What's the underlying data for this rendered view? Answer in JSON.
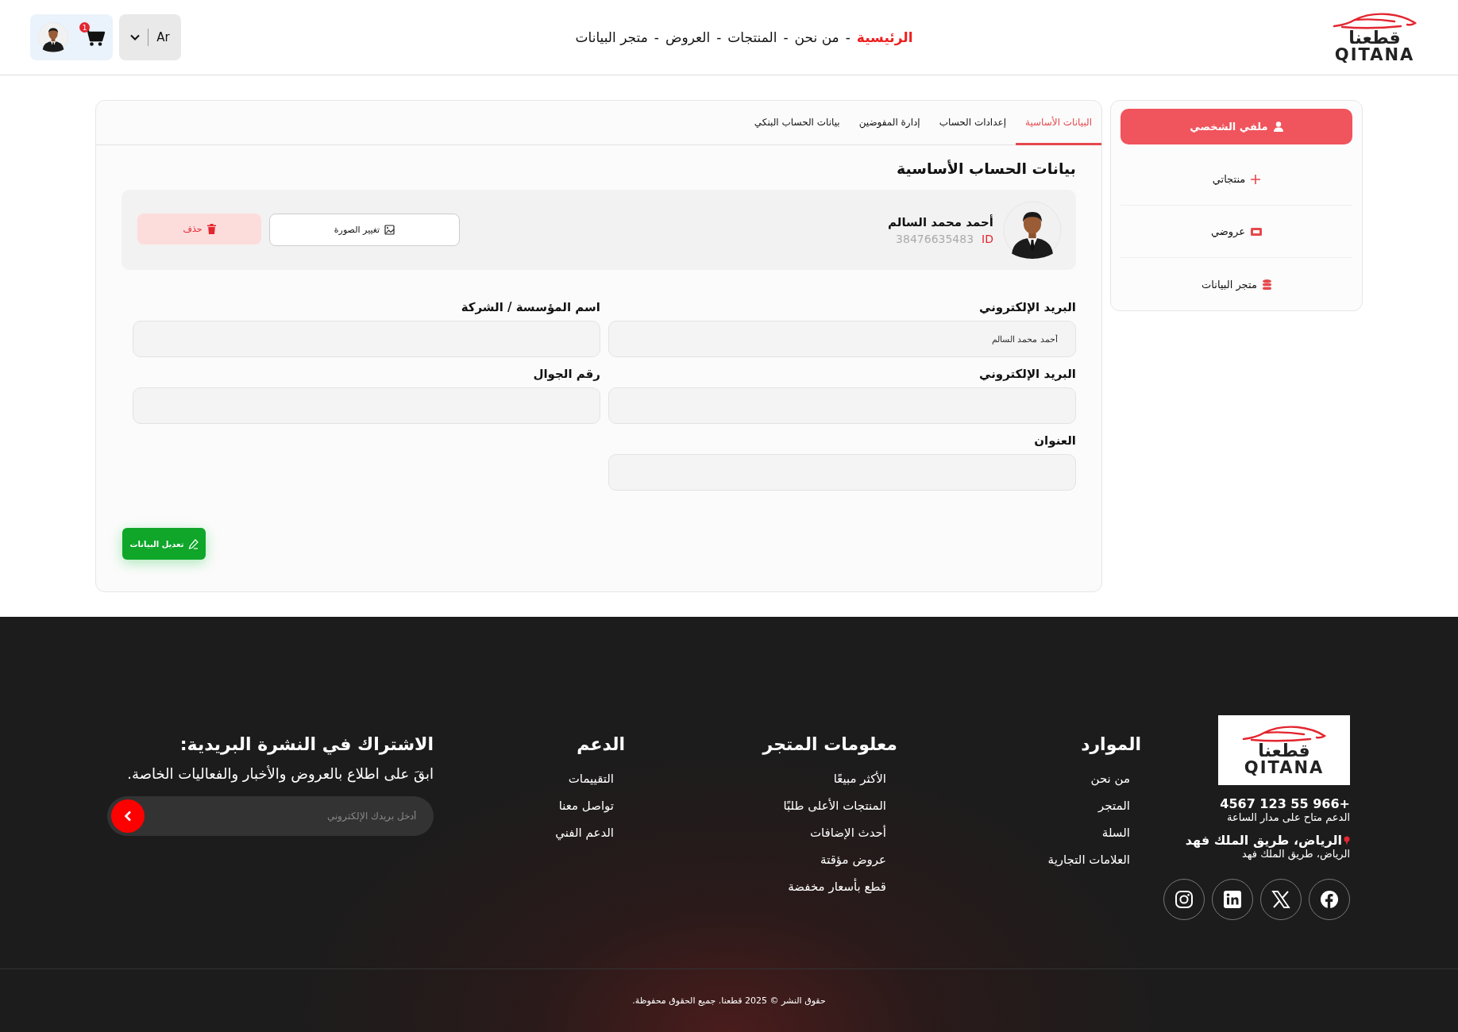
{
  "header": {
    "logo": {
      "arabic": "قطعنا",
      "latin": "QITANA"
    },
    "nav": [
      {
        "kind": "link",
        "label": "الرئيسية",
        "selected": true
      },
      {
        "kind": "separator",
        "label": "-"
      },
      {
        "kind": "link",
        "label": "من نحن",
        "selected": false
      },
      {
        "kind": "separator",
        "label": "-"
      },
      {
        "kind": "link",
        "label": "المنتجات",
        "selected": false
      },
      {
        "kind": "separator",
        "label": "-"
      },
      {
        "kind": "link",
        "label": "العروض",
        "selected": false
      },
      {
        "kind": "separator",
        "label": "-"
      },
      {
        "kind": "link",
        "label": "متجر البيانات",
        "selected": false
      }
    ],
    "language": "Ar",
    "cart_count": "1"
  },
  "sidebar": {
    "items": [
      {
        "label": "ملفي الشخصي",
        "selected": true
      },
      {
        "label": "منتجاتي",
        "selected": false
      },
      {
        "label": "عروضي",
        "selected": false
      },
      {
        "label": "متجر البيانات",
        "selected": false
      }
    ]
  },
  "tabs": [
    {
      "label": "البيانات الأساسية",
      "selected": true
    },
    {
      "label": "إعدادات الحساب",
      "selected": false
    },
    {
      "label": "إدارة المفوضين",
      "selected": false
    },
    {
      "label": "بيانات الحساب البنكي",
      "selected": false
    }
  ],
  "section_title": "بيانات الحساب الأساسية",
  "profile": {
    "name": "أحمد محمد السالم",
    "id_label": "ID",
    "id": "38476635483",
    "change_photo": "تغيير الصورة",
    "delete": "حذف"
  },
  "form": {
    "fields": [
      {
        "label": "البريد الإلكتروني",
        "value": "أحمد محمد السالم"
      },
      {
        "label": "اسم المؤسسة / الشركة"
      },
      {
        "label": "البريد الإلكتروني"
      },
      {
        "label": "رقم الجوال"
      },
      {
        "label": "العنوان"
      }
    ],
    "submit": "تعديل البيانات"
  },
  "footer": {
    "logo": {
      "arabic": "قطعنا",
      "latin": "QITANA"
    },
    "phone": "+966 55 123 4567",
    "hours": "الدعم متاح على مدار الساعة",
    "address": "الرياض، طريق الملك فهد",
    "address_detail": "الرياض، طريق الملك فهد",
    "social": [
      {
        "kind": "facebook"
      },
      {
        "kind": "x"
      },
      {
        "kind": "linkedin"
      },
      {
        "kind": "instagram"
      }
    ],
    "columns": [
      {
        "title": "الموارد",
        "links": [
          "من نحن",
          "المتجر",
          "السلة",
          "العلامات التجارية"
        ]
      },
      {
        "title": "معلومات المتجر",
        "links": [
          "الأكثر مبيعًا",
          "المنتجات الأعلى طلبًا",
          "أحدث الإضافات",
          "عروض مؤقتة",
          "قطع بأسعار مخفضة"
        ]
      },
      {
        "title": "الدعم",
        "links": [
          "التقييمات",
          "تواصل معنا",
          "الدعم الفني"
        ]
      }
    ],
    "newsletter": {
      "title": "الاشتراك في النشرة البريدية:",
      "text": "ابقَ على اطلاع بالعروض والأخبار والفعاليات الخاصة.",
      "placeholder": "أدخل بريدك الإلكتروني"
    },
    "copyright": "حقوق النشر © 2025 قطعنا. جميع الحقوق محفوظة."
  }
}
